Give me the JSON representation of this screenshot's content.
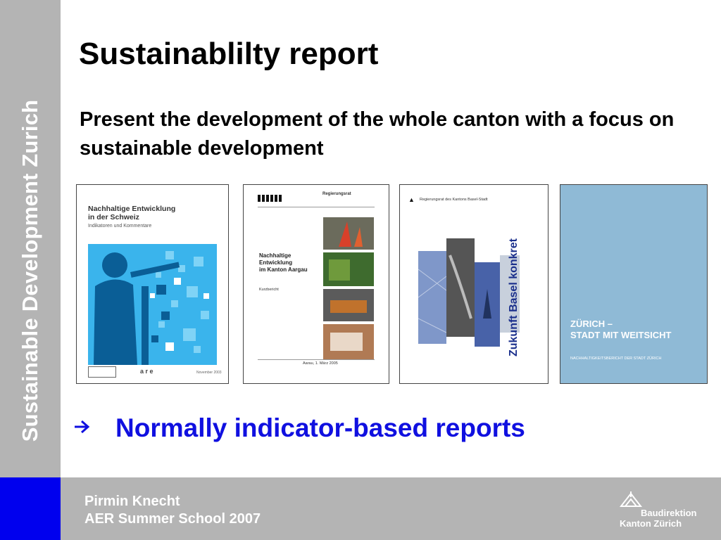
{
  "slide": {
    "title": "Sustainablilty report",
    "subtitle": "Present the development of the whole canton with a focus on sustainable development",
    "sidebar_text": "Sustainable Development Zurich",
    "bullet": "Normally indicator-based reports",
    "bullet_icon": "right-arrow-icon"
  },
  "covers": [
    {
      "title_line1": "Nachhaltige Entwicklung",
      "title_line2": "in der Schweiz",
      "subtitle": "Indikatoren und Kommentare",
      "date": "November 2003"
    },
    {
      "header": "Regierungsrat",
      "title_line1": "Nachhaltige",
      "title_line2": "Entwicklung",
      "title_line3": "im Kanton Aargau",
      "kind": "Kurzbericht",
      "date": "Aarau, 1. März 2005"
    },
    {
      "header": "Regierungsrat des Kantons Basel-Stadt",
      "title": "Zukunft Basel konkret"
    },
    {
      "title_line1": "ZÜRICH –",
      "title_line2": "STADT MIT WEITSICHT",
      "subtitle": "NACHHALTIGKEITSBERICHT DER STADT ZÜRICH"
    }
  ],
  "footer": {
    "author": "Pirmin Knecht",
    "event": "AER Summer School 2007",
    "logo_line1": "Baudirektion",
    "logo_line2": "Kanton Zürich"
  },
  "colors": {
    "sidebar": "#b4b4b4",
    "accent_blue": "#0000ee",
    "bullet_blue": "#1010e0"
  }
}
